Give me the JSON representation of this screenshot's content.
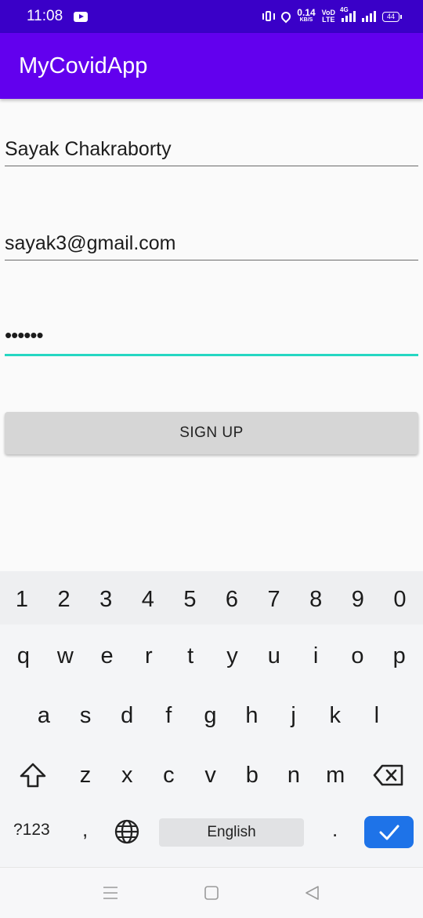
{
  "status_bar": {
    "time": "11:08",
    "speed_value": "0.14",
    "speed_unit": "KB/S",
    "volte_top": "VoD",
    "volte_bottom": "LTE",
    "network_type": "4G",
    "battery": "44"
  },
  "app_bar": {
    "title": "MyCovidApp"
  },
  "form": {
    "name_value": "Sayak Chakraborty",
    "email_value": "sayak3@gmail.com",
    "password_value": "••••••",
    "signup_label": "SIGN UP"
  },
  "keyboard": {
    "numbers": [
      "1",
      "2",
      "3",
      "4",
      "5",
      "6",
      "7",
      "8",
      "9",
      "0"
    ],
    "row1": [
      "q",
      "w",
      "e",
      "r",
      "t",
      "y",
      "u",
      "i",
      "o",
      "p"
    ],
    "row2": [
      "a",
      "s",
      "d",
      "f",
      "g",
      "h",
      "j",
      "k",
      "l"
    ],
    "row3": [
      "z",
      "x",
      "c",
      "v",
      "b",
      "n",
      "m"
    ],
    "symbols_label": "?123",
    "comma": ",",
    "language_label": "English",
    "period": ".",
    "accent_color": "#1e73e8"
  },
  "colors": {
    "status_bar": "#3a00c8",
    "app_bar": "#6200ee",
    "focus_underline": "#26d7c2"
  }
}
